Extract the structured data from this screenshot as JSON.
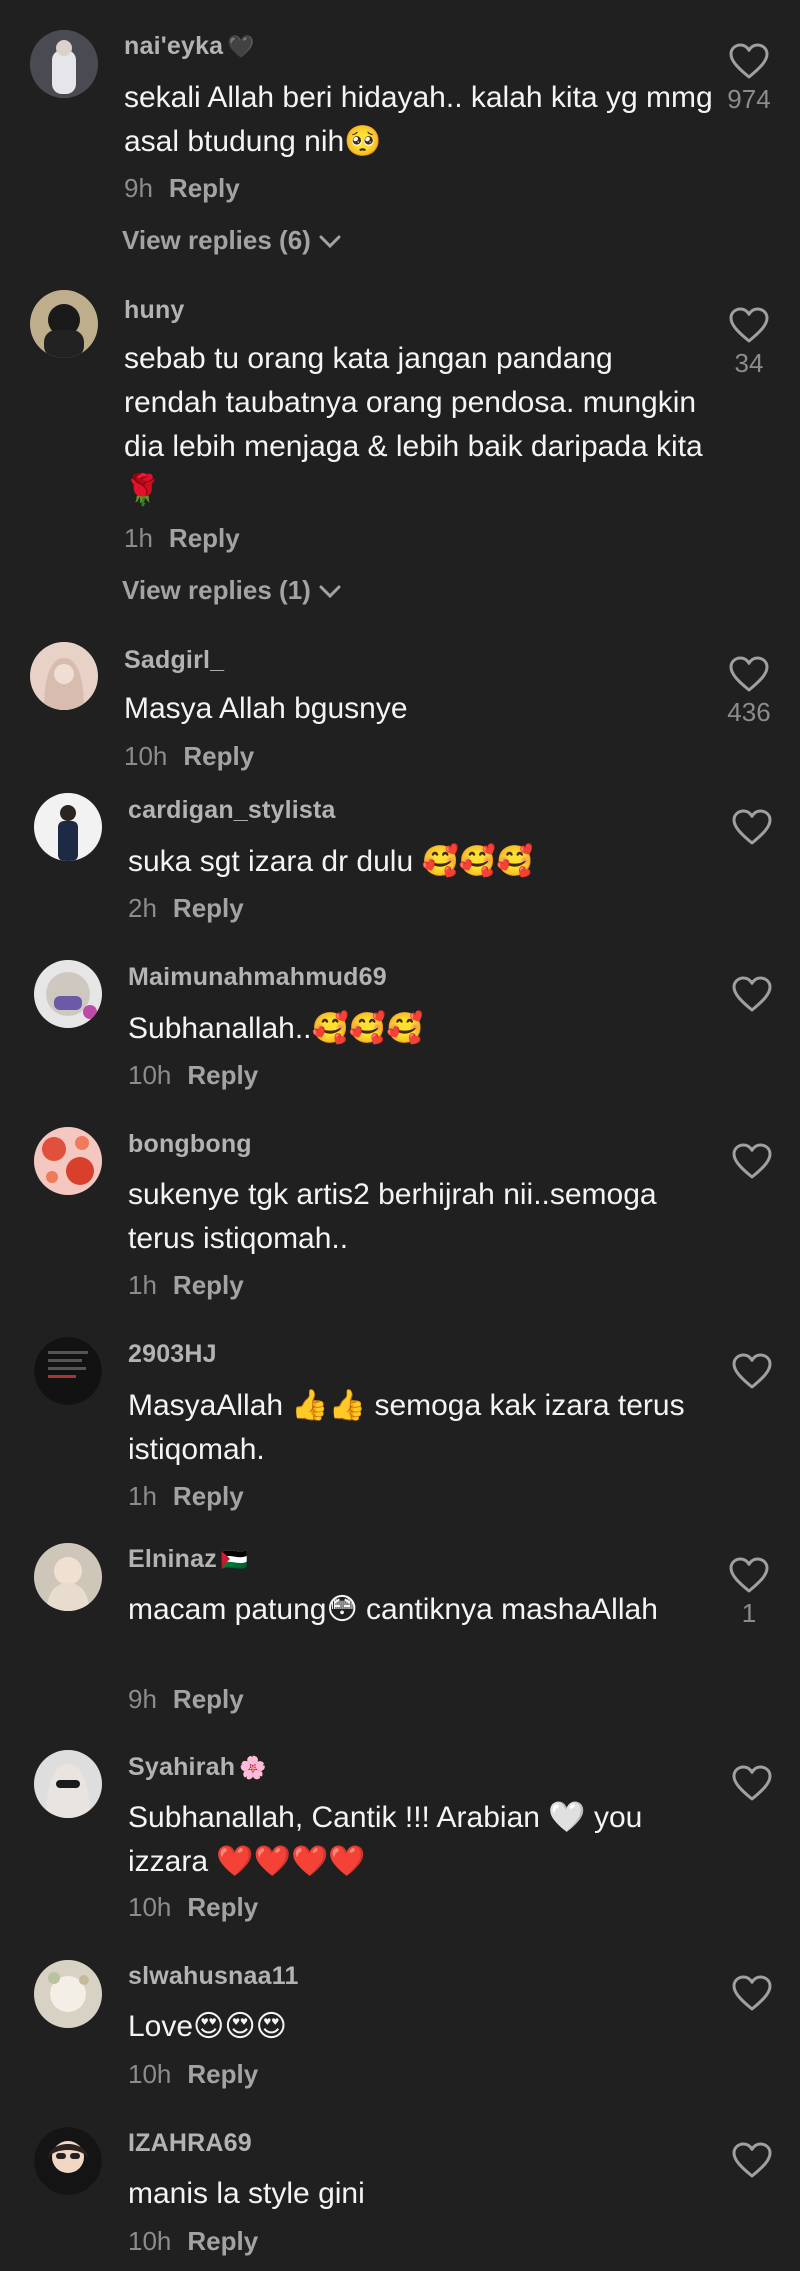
{
  "colors": {
    "background": "#202020",
    "text": "#f4f4f4",
    "muted": "#8c8c8c"
  },
  "comments": [
    {
      "username": "nai'eyka",
      "user_emoji": "🖤",
      "text": "sekali Allah beri hidayah.. kalah kita yg mmg asal btudung nih🥺",
      "time": "9h",
      "reply_label": "Reply",
      "likes": "974",
      "view_replies": "View replies (6)"
    },
    {
      "username": "huny",
      "user_emoji": "",
      "text": "sebab tu orang kata jangan pandang rendah taubatnya orang pendosa. mungkin dia lebih menjaga & lebih baik daripada kita 🌹",
      "time": "1h",
      "reply_label": "Reply",
      "likes": "34",
      "view_replies": "View replies (1)"
    },
    {
      "username": "Sadgirl_",
      "user_emoji": "",
      "text": "Masya Allah bgusnye",
      "time": "10h",
      "reply_label": "Reply",
      "likes": "436",
      "view_replies": ""
    },
    {
      "username": "cardigan_stylista",
      "user_emoji": "",
      "text": "suka sgt izara dr dulu 🥰🥰🥰",
      "time": "2h",
      "reply_label": "Reply",
      "likes": "",
      "view_replies": ""
    },
    {
      "username": "Maimunahmahmud69",
      "user_emoji": "",
      "text": "Subhanallah..🥰🥰🥰",
      "time": "10h",
      "reply_label": "Reply",
      "likes": "",
      "view_replies": ""
    },
    {
      "username": "bongbong",
      "user_emoji": "",
      "text": "sukenye tgk artis2 berhijrah nii..semoga terus istiqomah..",
      "time": "1h",
      "reply_label": "Reply",
      "likes": "",
      "view_replies": ""
    },
    {
      "username": "2903HJ",
      "user_emoji": "",
      "text": "MasyaAllah 👍👍 semoga kak izara terus istiqomah.",
      "time": "1h",
      "reply_label": "Reply",
      "likes": "",
      "view_replies": ""
    },
    {
      "username": "Elninaz",
      "user_emoji": "🇵🇸",
      "text": "macam patung😳 cantiknya mashaAllah",
      "time": "9h",
      "reply_label": "Reply",
      "likes": "1",
      "view_replies": ""
    },
    {
      "username": "Syahirah",
      "user_emoji": "🌸",
      "text": "Subhanallah, Cantik !!! Arabian 🤍 you izzara ❤️❤️❤️❤️",
      "time": "10h",
      "reply_label": "Reply",
      "likes": "",
      "view_replies": ""
    },
    {
      "username": "slwahusnaa11",
      "user_emoji": "",
      "text": "Love😍😍😍",
      "time": "10h",
      "reply_label": "Reply",
      "likes": "",
      "view_replies": ""
    },
    {
      "username": "IZAHRA69",
      "user_emoji": "",
      "text": "manis la style gini",
      "time": "10h",
      "reply_label": "Reply",
      "likes": "",
      "view_replies": ""
    }
  ]
}
